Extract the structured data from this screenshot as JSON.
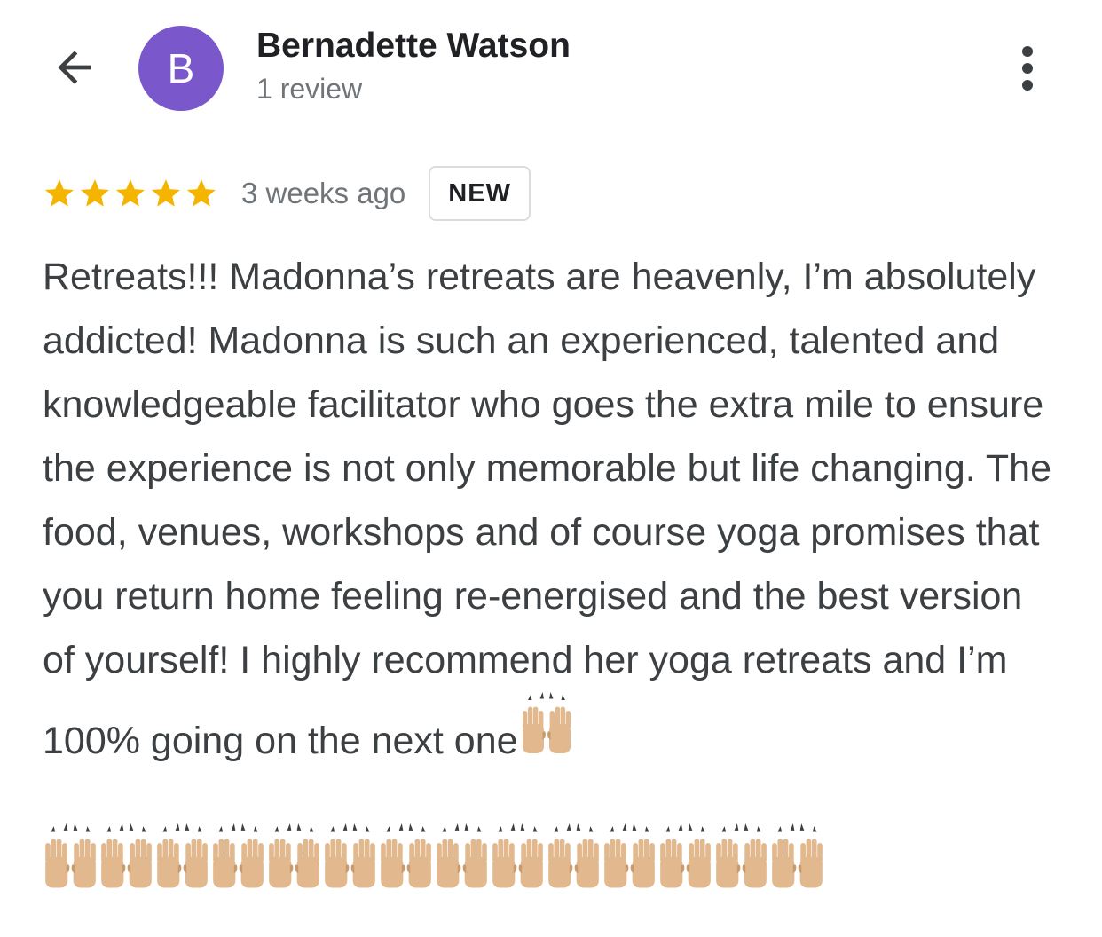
{
  "reviewer": {
    "initial": "B",
    "name": "Bernadette Watson",
    "review_count": "1 review",
    "avatar_color": "#7b57cc"
  },
  "review": {
    "rating": 5,
    "max_rating": 5,
    "star_color": "#f4b400",
    "time_ago": "3 weeks ago",
    "badge": "NEW",
    "text": "Retreats!!! Madonna’s retreats are heavenly, I’m absolutely addicted! Madonna is such an experienced, talented and knowledgeable facilitator who goes the extra mile to ensure the experience is not only memorable but life changing. The food, venues, workshops and of course yoga promises that you return home feeling re-energised and the best version of yourself! I highly recommend her yoga retreats and I’m 100% going on the next one",
    "emoji_name": "raising-hands-emoji",
    "emoji_inline_count": 1,
    "emoji_trailing_count": 14
  },
  "icons": {
    "back": "arrow-back-icon",
    "more": "more-vert-icon",
    "star": "star-icon"
  }
}
